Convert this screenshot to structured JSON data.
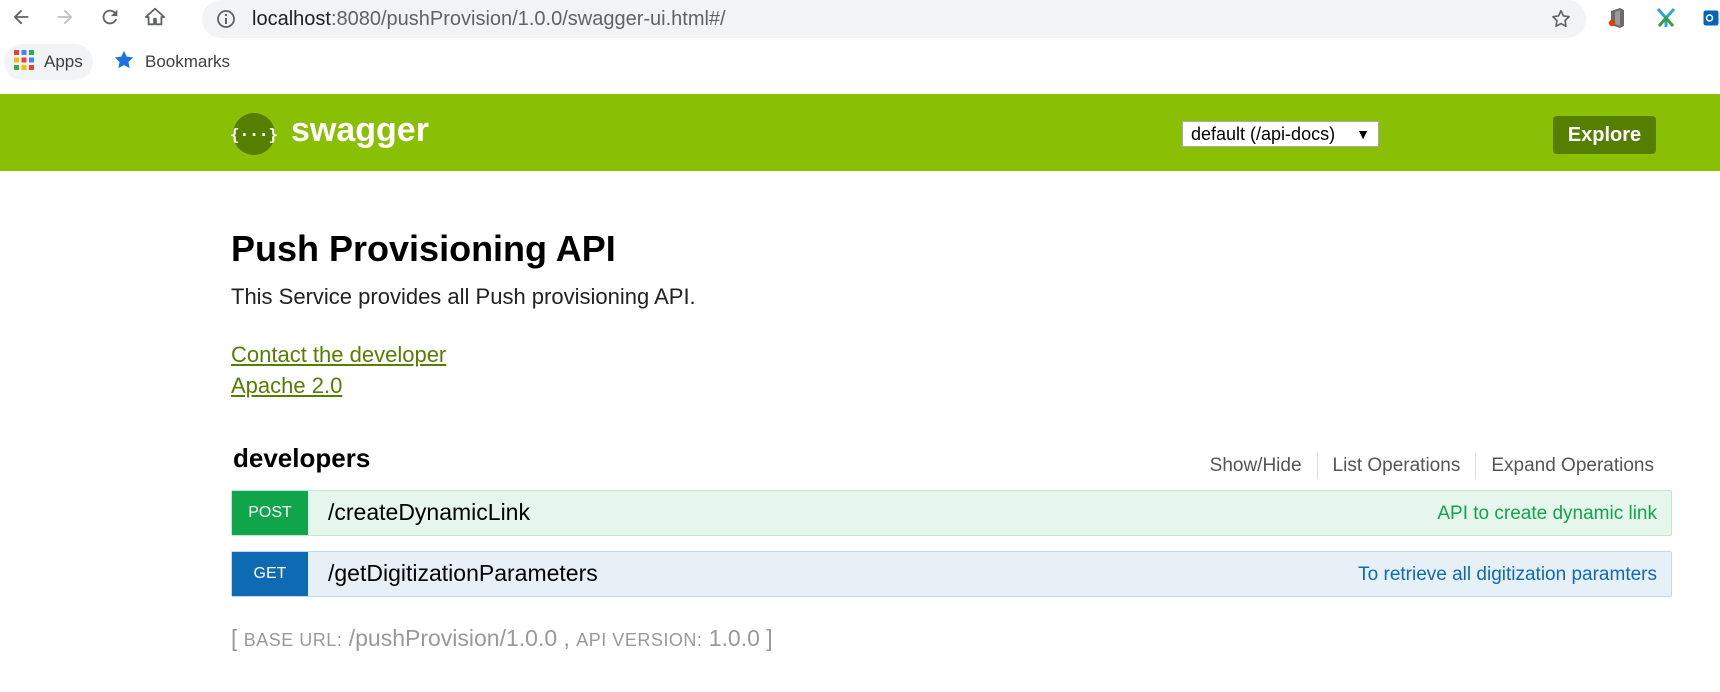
{
  "browser": {
    "url_host": "localhost",
    "url_rest": ":8080/pushProvision/1.0.0/swagger-ui.html#/",
    "bookmarks": [
      {
        "label": "Apps"
      },
      {
        "label": "Bookmarks"
      }
    ]
  },
  "header": {
    "logo_glyph": "{···}",
    "logo_text": "swagger",
    "api_selector": {
      "selected": "default (/api-docs)",
      "arrow": "▼"
    },
    "explore_label": "Explore",
    "colors": {
      "bar": "#89bf04",
      "accent": "#547f00"
    }
  },
  "info": {
    "title": "Push Provisioning API",
    "description": "This Service provides all Push provisioning API.",
    "contact_link": "Contact the developer",
    "license_link": "Apache 2.0"
  },
  "resource": {
    "name": "developers",
    "actions": [
      "Show/Hide",
      "List Operations",
      "Expand Operations"
    ],
    "operations": [
      {
        "method": "POST",
        "path": "/createDynamicLink",
        "summary": "API to create dynamic link",
        "color": "#10a54a"
      },
      {
        "method": "GET",
        "path": "/getDigitizationParameters",
        "summary": "To retrieve all digitization paramters",
        "color": "#0f6ab4"
      }
    ]
  },
  "footer": {
    "open_bracket": "[",
    "base_url_label": "BASE URL:",
    "base_url": "/pushProvision/1.0.0",
    "separator": ",",
    "api_version_label": "API VERSION:",
    "api_version": "1.0.0",
    "close_bracket": "]"
  }
}
